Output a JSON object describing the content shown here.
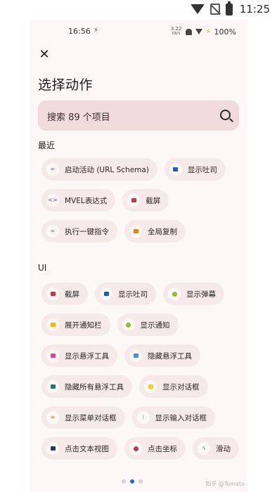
{
  "outer_status": {
    "time": "11:25"
  },
  "inner_status": {
    "time": "16:56",
    "net_rate_top": "3.22",
    "net_rate_bottom": "KB/S",
    "battery": "100%"
  },
  "dialog": {
    "title": "选择动作",
    "search_placeholder": "搜索 89 个项目",
    "sections": [
      {
        "label": "最近",
        "rows": [
          [
            {
              "label": "启动活动 (URL Schema)",
              "icon": "link-icon",
              "color": "#8a3fc7",
              "glyph": "∞"
            },
            {
              "label": "显示吐司",
              "icon": "toast-icon",
              "color": "#1f5fb8",
              "glyph": ""
            }
          ],
          [
            {
              "label": "MVEL表达式",
              "icon": "code-icon",
              "color": "#7a3bb5",
              "glyph": "<>"
            },
            {
              "label": "截屏",
              "icon": "screenshot-icon",
              "color": "#c8334b",
              "glyph": ""
            }
          ],
          [
            {
              "label": "执行一键指令",
              "icon": "link-icon",
              "color": "#d84a62",
              "glyph": "∞"
            },
            {
              "label": "全局复制",
              "icon": "copy-icon",
              "color": "#e3841f",
              "glyph": ""
            }
          ]
        ]
      },
      {
        "label": "UI",
        "rows": [
          [
            {
              "label": "截屏",
              "icon": "screenshot-icon",
              "color": "#c8334b",
              "glyph": ""
            },
            {
              "label": "显示吐司",
              "icon": "toast-icon",
              "color": "#1f5fb8",
              "glyph": ""
            },
            {
              "label": "显示弹幕",
              "icon": "danmaku-icon",
              "color": "#8cbe2a",
              "glyph": ""
            }
          ],
          [
            {
              "label": "展开通知栏",
              "icon": "notification-shade-icon",
              "color": "#f3b313",
              "glyph": ""
            },
            {
              "label": "显示通知",
              "icon": "notification-icon",
              "color": "#8cbe2a",
              "glyph": ""
            }
          ],
          [
            {
              "label": "显示悬浮工具",
              "icon": "floating-tool-icon",
              "color": "#d84a8a",
              "glyph": ""
            },
            {
              "label": "隐藏悬浮工具",
              "icon": "floating-tool-icon",
              "color": "#4a90d8",
              "glyph": ""
            }
          ],
          [
            {
              "label": "隐藏所有悬浮工具",
              "icon": "floating-tool-icon",
              "color": "#1f7a6a",
              "glyph": ""
            },
            {
              "label": "显示对话框",
              "icon": "dialog-icon",
              "color": "#f3d313",
              "glyph": ""
            }
          ],
          [
            {
              "label": "显示菜单对话框",
              "icon": "menu-icon",
              "color": "#e3841f",
              "glyph": "≡"
            },
            {
              "label": "显示输入对话框",
              "icon": "input-icon",
              "color": "#d84ad0",
              "glyph": "⁞"
            }
          ],
          [
            {
              "label": "点击文本视图",
              "icon": "text-view-icon",
              "color": "#1f3a6a",
              "glyph": ""
            },
            {
              "label": "点击坐标",
              "icon": "tap-icon",
              "color": "#c8334b",
              "glyph": ""
            },
            {
              "label": "滑动",
              "icon": "swipe-icon",
              "color": "#2a9a5a",
              "glyph": "ร"
            }
          ]
        ]
      }
    ]
  },
  "watermark": "知乎 @Tomato"
}
